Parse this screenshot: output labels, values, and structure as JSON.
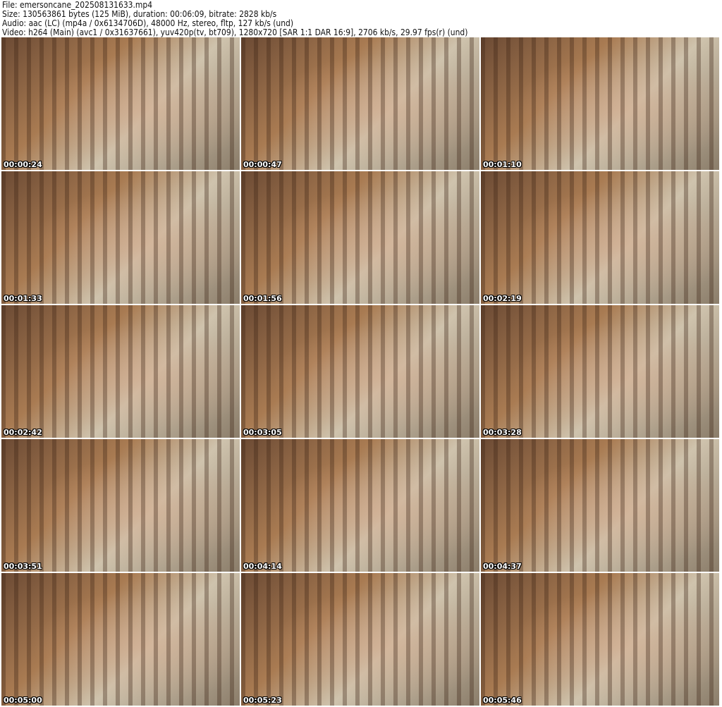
{
  "header": {
    "file": "File: emersoncane_202508131633.mp4",
    "size": "Size: 130563861 bytes (125 MiB), duration: 00:06:09, bitrate: 2828 kb/s",
    "audio": "Audio: aac (LC) (mp4a / 0x6134706D), 48000 Hz, stereo, fltp, 127 kb/s (und)",
    "video": "Video: h264 (Main) (avc1 / 0x31637661), yuv420p(tv, bt709), 1280x720 [SAR 1:1 DAR 16:9], 2706 kb/s, 29.97 fps(r) (und)"
  },
  "thumbnails": [
    "00:00:24",
    "00:00:47",
    "00:01:10",
    "00:01:33",
    "00:01:56",
    "00:02:19",
    "00:02:42",
    "00:03:05",
    "00:03:28",
    "00:03:51",
    "00:04:14",
    "00:04:37",
    "00:05:00",
    "00:05:23",
    "00:05:46"
  ]
}
